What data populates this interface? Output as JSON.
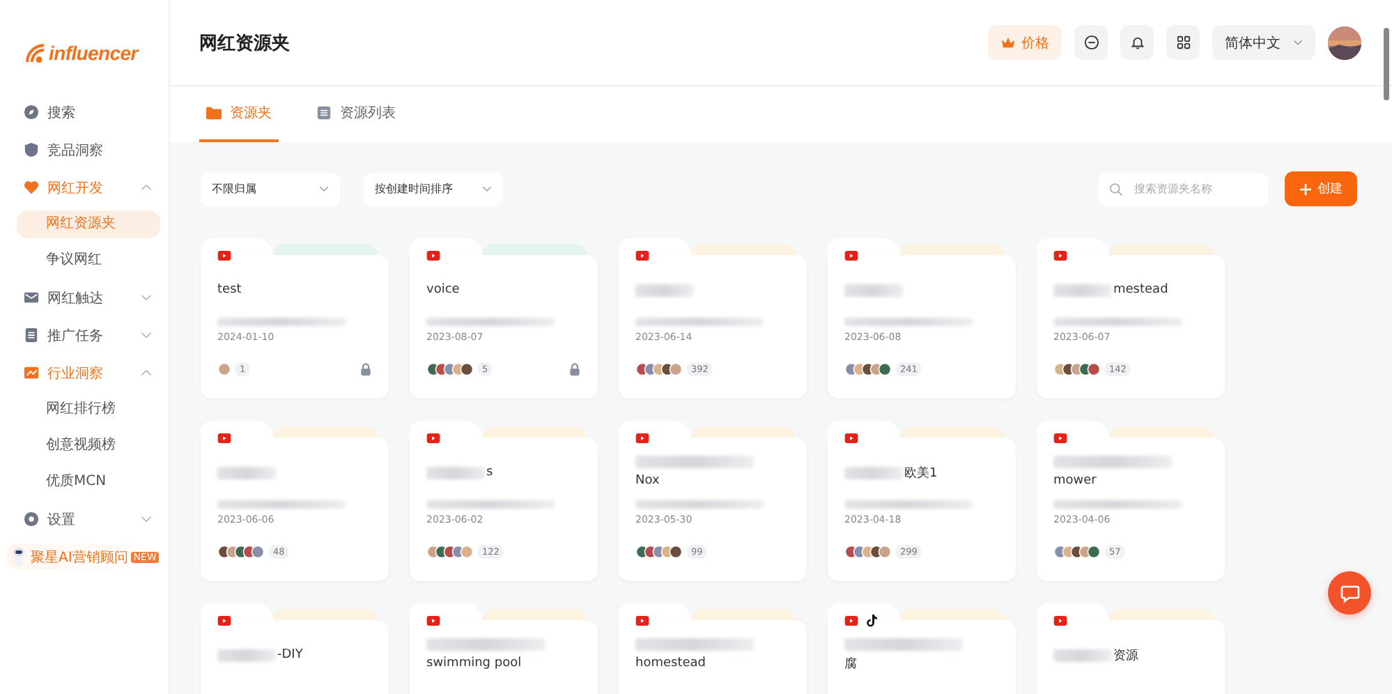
{
  "logo": {
    "text": "influencer"
  },
  "sidebar": {
    "items": [
      {
        "label": "搜索",
        "kind": "search",
        "has_children": false,
        "active": false
      },
      {
        "label": "竞品洞察",
        "kind": "shield",
        "has_children": false,
        "active": false
      },
      {
        "label": "网红开发",
        "kind": "heart",
        "expanded": true,
        "has_children": true,
        "active": true,
        "children": [
          {
            "label": "网红资源夹",
            "selected": true
          },
          {
            "label": "争议网红",
            "selected": false
          }
        ]
      },
      {
        "label": "网红触达",
        "kind": "mail",
        "expanded": false,
        "has_children": true,
        "active": false
      },
      {
        "label": "推广任务",
        "kind": "doc",
        "expanded": false,
        "has_children": true,
        "active": false
      },
      {
        "label": "行业洞察",
        "kind": "chart",
        "expanded": true,
        "has_children": true,
        "active": true,
        "children": [
          {
            "label": "网红排行榜",
            "selected": false
          },
          {
            "label": "创意视频榜",
            "selected": false
          },
          {
            "label": "优质MCN",
            "selected": false
          }
        ]
      },
      {
        "label": "设置",
        "kind": "gear",
        "expanded": false,
        "has_children": true,
        "active": false
      }
    ],
    "promo": {
      "label": "聚星AI营销顾问",
      "badge": "NEW"
    }
  },
  "header": {
    "title": "网红资源夹",
    "price_button": "价格",
    "language": "简体中文"
  },
  "tabs": [
    {
      "label": "资源夹",
      "kind": "folder",
      "selected": true
    },
    {
      "label": "资源列表",
      "kind": "list",
      "selected": false
    }
  ],
  "filters": {
    "owner": "不限归属",
    "sort": "按创建时间排序",
    "search": {
      "placeholder": "搜索资源夹名称"
    },
    "create_button": "创建"
  },
  "folders": [
    {
      "platforms": [
        {
          "kind": "youtube"
        }
      ],
      "color": "#e3f5ee",
      "hidden_line": false,
      "hidden_prefix": false,
      "title": "test",
      "date": "2024-01-10",
      "count": "1",
      "locked": true
    },
    {
      "platforms": [
        {
          "kind": "youtube"
        }
      ],
      "color": "#e3f5ee",
      "hidden_line": false,
      "hidden_prefix": false,
      "title": "voice",
      "date": "2023-08-07",
      "count": "5",
      "locked": true
    },
    {
      "platforms": [
        {
          "kind": "youtube"
        }
      ],
      "color": "#fcf3e0",
      "hidden_line": false,
      "hidden_prefix": true,
      "date": "2023-06-14",
      "count": "392",
      "locked": false
    },
    {
      "platforms": [
        {
          "kind": "youtube"
        }
      ],
      "color": "#fcf3e0",
      "hidden_line": false,
      "hidden_prefix": true,
      "date": "2023-06-08",
      "count": "241",
      "locked": false
    },
    {
      "platforms": [
        {
          "kind": "youtube"
        }
      ],
      "color": "#fcf3e0",
      "hidden_line": false,
      "hidden_prefix": true,
      "title": "mestead",
      "date": "2023-06-07",
      "count": "142",
      "locked": false
    },
    {
      "platforms": [
        {
          "kind": "youtube"
        }
      ],
      "color": "#fcf3e0",
      "hidden_line": false,
      "hidden_prefix": true,
      "date": "2023-06-06",
      "count": "48",
      "locked": false
    },
    {
      "platforms": [
        {
          "kind": "youtube"
        }
      ],
      "color": "#fcf3e0",
      "hidden_line": false,
      "hidden_prefix": true,
      "title": "s",
      "date": "2023-06-02",
      "count": "122",
      "locked": false
    },
    {
      "platforms": [
        {
          "kind": "youtube"
        }
      ],
      "color": "#fcf3e0",
      "hidden_line": true,
      "hidden_prefix": false,
      "title": "Nox",
      "date": "2023-05-30",
      "count": "99",
      "locked": false
    },
    {
      "platforms": [
        {
          "kind": "youtube"
        }
      ],
      "color": "#fcf3e0",
      "hidden_line": false,
      "hidden_prefix": true,
      "title": "欧美1",
      "date": "2023-04-18",
      "count": "299",
      "locked": false
    },
    {
      "platforms": [
        {
          "kind": "youtube"
        }
      ],
      "color": "#fcf3e0",
      "hidden_line": true,
      "hidden_prefix": false,
      "title": "mower",
      "date": "2023-04-06",
      "count": "57",
      "locked": false
    },
    {
      "platforms": [
        {
          "kind": "youtube"
        }
      ],
      "color": "#fcf3e0",
      "hidden_line": false,
      "hidden_prefix": true,
      "title": "-DIY"
    },
    {
      "platforms": [
        {
          "kind": "youtube"
        }
      ],
      "color": "#fcf3e0",
      "hidden_line": true,
      "hidden_prefix": false,
      "title": "swimming pool"
    },
    {
      "platforms": [
        {
          "kind": "youtube"
        }
      ],
      "color": "#fcf3e0",
      "hidden_line": true,
      "hidden_prefix": false,
      "title": "homestead"
    },
    {
      "platforms": [
        {
          "kind": "youtube"
        },
        {
          "kind": "tiktok"
        }
      ],
      "color": "#fcf3e0",
      "hidden_line": true,
      "hidden_prefix": false,
      "title": "腐"
    },
    {
      "platforms": [
        {
          "kind": "youtube"
        }
      ],
      "color": "#fcf3e0",
      "hidden_line": false,
      "hidden_prefix": true,
      "title": "资源"
    }
  ]
}
